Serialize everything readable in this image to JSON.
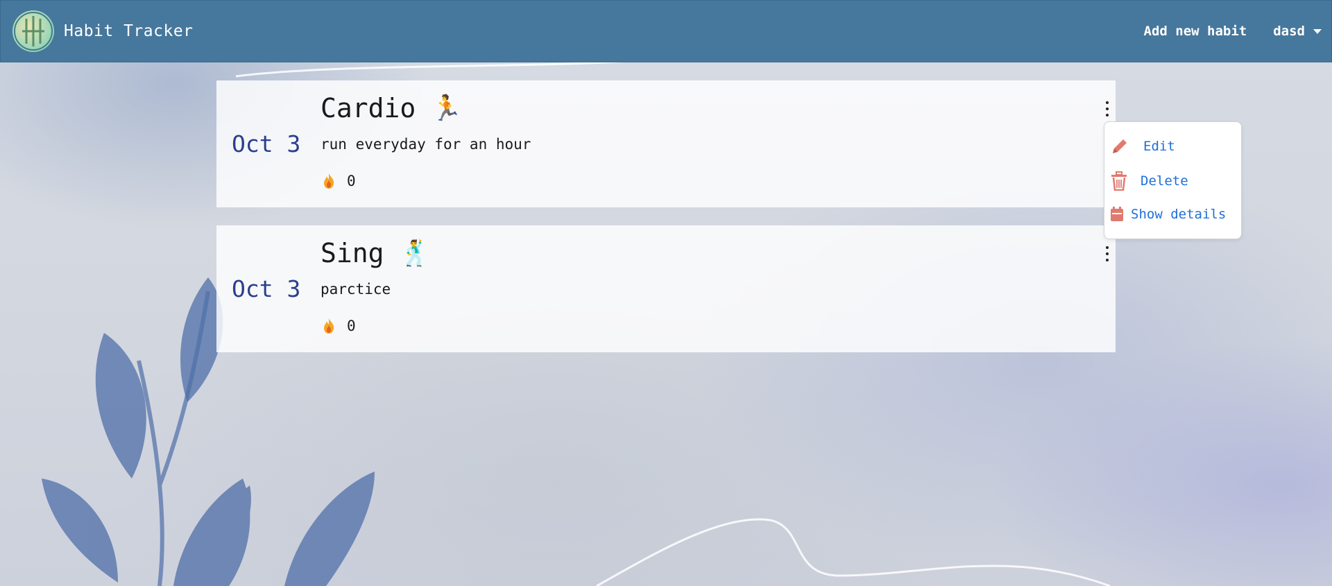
{
  "navbar": {
    "brand_title": "Habit Tracker",
    "add_habit_label": "Add new habit",
    "user_name": "dasd"
  },
  "habits": [
    {
      "date": "Oct 3",
      "title": "Cardio",
      "emoji": "🏃",
      "description": "run everyday for an hour",
      "streak": "0"
    },
    {
      "date": "Oct 3",
      "title": "Sing",
      "emoji": "🕺",
      "description": "parctice",
      "streak": "0"
    }
  ],
  "dropdown_menu": {
    "items": [
      {
        "label": "Edit",
        "icon": "pencil-icon"
      },
      {
        "label": "Delete",
        "icon": "trash-icon"
      },
      {
        "label": "Show details",
        "icon": "calendar-icon"
      }
    ]
  },
  "colors": {
    "navbar": "#46779c",
    "date_text": "#2b3e8e",
    "menu_link": "#1e6fd9",
    "menu_icon": "#e07a6f",
    "flame": "#f5a623"
  }
}
